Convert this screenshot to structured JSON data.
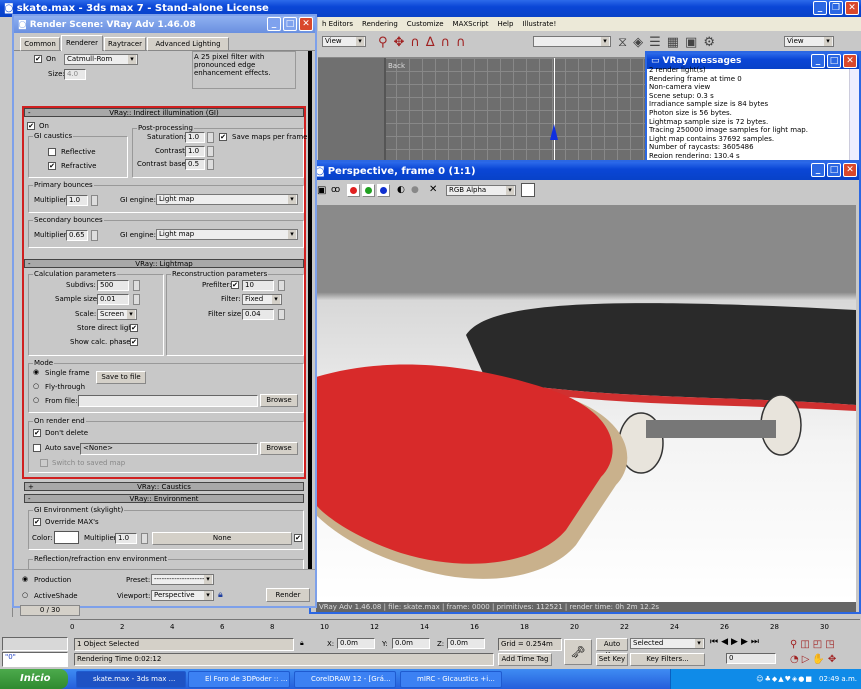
{
  "main_window": {
    "title": "skate.max - 3ds max 7  - Stand-alone License"
  },
  "menu": [
    "h Editors",
    "Rendering",
    "Customize",
    "MAXScript",
    "Help",
    "Illustrate!"
  ],
  "toolbar": {
    "view_dropdown": "View",
    "view_dropdown2": "View",
    "selection_set": ""
  },
  "viewport_back": {
    "label": "Back"
  },
  "render_scene": {
    "title": "Render Scene: VRay Adv 1.46.08",
    "tabs": [
      "Common",
      "Renderer",
      "Raytracer",
      "Advanced Lighting"
    ],
    "active_tab": "Renderer",
    "filter": {
      "on_label": "On",
      "on": true,
      "type": "Catmull-Rom",
      "size_label": "Size:",
      "size": "4.0",
      "description": "A 25 pixel filter with pronounced edge enhancement effects."
    },
    "gi": {
      "rollout": "VRay:: Indirect illumination (GI)",
      "collapse": "-",
      "on_label": "On",
      "on": true,
      "caustics_title": "GI caustics",
      "reflective_label": "Reflective",
      "reflective": false,
      "refractive_label": "Refractive",
      "refractive": true,
      "post_title": "Post-processing",
      "saturation_label": "Saturation:",
      "saturation": "1.0",
      "contrast_label": "Contrast:",
      "contrast": "1.0",
      "contrast_base_label": "Contrast base:",
      "contrast_base": "0.5",
      "save_maps_label": "Save maps per frame",
      "save_maps": true,
      "primary_title": "Primary bounces",
      "primary_mult_label": "Multiplier:",
      "primary_mult": "1.0",
      "primary_engine_label": "GI engine:",
      "primary_engine": "Light map",
      "secondary_title": "Secondary bounces",
      "secondary_mult_label": "Multiplier:",
      "secondary_mult": "0.65",
      "secondary_engine_label": "GI engine:",
      "secondary_engine": "Light map"
    },
    "lightmap": {
      "rollout": "VRay:: Lightmap",
      "collapse": "-",
      "calc_title": "Calculation parameters",
      "subdivs_label": "Subdivs:",
      "subdivs": "500",
      "sample_size_label": "Sample size:",
      "sample_size": "0.01",
      "scale_label": "Scale:",
      "scale": "Screen",
      "store_direct_label": "Store direct light",
      "store_direct": true,
      "show_calc_label": "Show calc. phase",
      "show_calc": true,
      "recon_title": "Reconstruction parameters",
      "prefilter_label": "Prefilter:",
      "prefilter": true,
      "prefilter_value": "10",
      "filter_label": "Filter:",
      "filter": "Fixed",
      "filter_size_label": "Filter size:",
      "filter_size": "0.04",
      "mode_title": "Mode",
      "modes": [
        "Single frame",
        "Fly-through",
        "From file:"
      ],
      "mode_selected": "Single frame",
      "save_to_file": "Save to file",
      "browse": "Browse",
      "file_path": "",
      "render_end_title": "On render end",
      "dont_delete_label": "Don't delete",
      "dont_delete": true,
      "auto_save_label": "Auto save:",
      "auto_save": false,
      "auto_save_path": "<None>",
      "browse2": "Browse",
      "switch_label": "Switch to saved map"
    },
    "caustics": {
      "rollout": "VRay:: Caustics",
      "collapse": "+"
    },
    "environment": {
      "rollout": "VRay:: Environment",
      "collapse": "-",
      "gi_env_title": "GI Environment (skylight)",
      "override_label": "Override MAX's",
      "override": true,
      "color_label": "Color:",
      "color": "#ffffff",
      "mult_label": "Multiplier:",
      "mult": "1.0",
      "map": "None",
      "map_on": true,
      "refl_title": "Reflection/refraction env environment"
    },
    "footer": {
      "production": "Production",
      "activeshade": "ActiveShade",
      "selected": "Production",
      "preset_label": "Preset:",
      "preset": "--------------------",
      "viewport_label": "Viewport:",
      "viewport": "Perspective",
      "render": "Render"
    }
  },
  "vray_messages": {
    "title": "VRay messages",
    "lines": [
      "2 render light(s)",
      "Rendering frame at time 0",
      "Non-camera view",
      "Scene setup: 0.3 s",
      "Irradiance sample size is 84 bytes",
      "Photon size is 56 bytes.",
      "Lightmap sample size is 72 bytes.",
      "Tracing 250000 image samples for light map.",
      "Light map contains 37692 samples.",
      "Number of raycasts: 3605486",
      "Region rendering: 130.4 s"
    ]
  },
  "frame_buffer": {
    "title": "Perspective, frame 0 (1:1)",
    "channel": "RGB Alpha",
    "status": "VRay Adv 1.46.08 | file: skate.max | frame: 0000 | primitives: 112521 | render time: 0h 2m 12.2s",
    "channel_colors": [
      "#e02020",
      "#20a020",
      "#1030d0"
    ]
  },
  "timeline": {
    "slider": "0 / 30",
    "ticks": [
      "0",
      "2",
      "4",
      "6",
      "8",
      "10",
      "12",
      "14",
      "16",
      "18",
      "20",
      "22",
      "24",
      "26",
      "28",
      "30"
    ]
  },
  "status": {
    "selected": "1 Object Selected",
    "render_time": "Rendering Time  0:02:12",
    "x_label": "X:",
    "x": "0.0m",
    "y_label": "Y:",
    "y": "0.0m",
    "z_label": "Z:",
    "z": "0.0m",
    "grid": "Grid = 0.254m",
    "add_time_tag": "Add Time Tag",
    "auto_key": "Auto Key",
    "set_key": "Set Key",
    "key_mode": "Selected",
    "key_filters": "Key Filters...",
    "frame": "0",
    "maxscript": "\"0\""
  },
  "taskbar": {
    "start": "Inicio",
    "items": [
      "skate.max - 3ds max ...",
      "El Foro de 3DPoder :: ...",
      "CorelDRAW 12 - [Grá...",
      "mIRC - GIcaustics +i..."
    ],
    "clock": "02:49 a.m."
  }
}
